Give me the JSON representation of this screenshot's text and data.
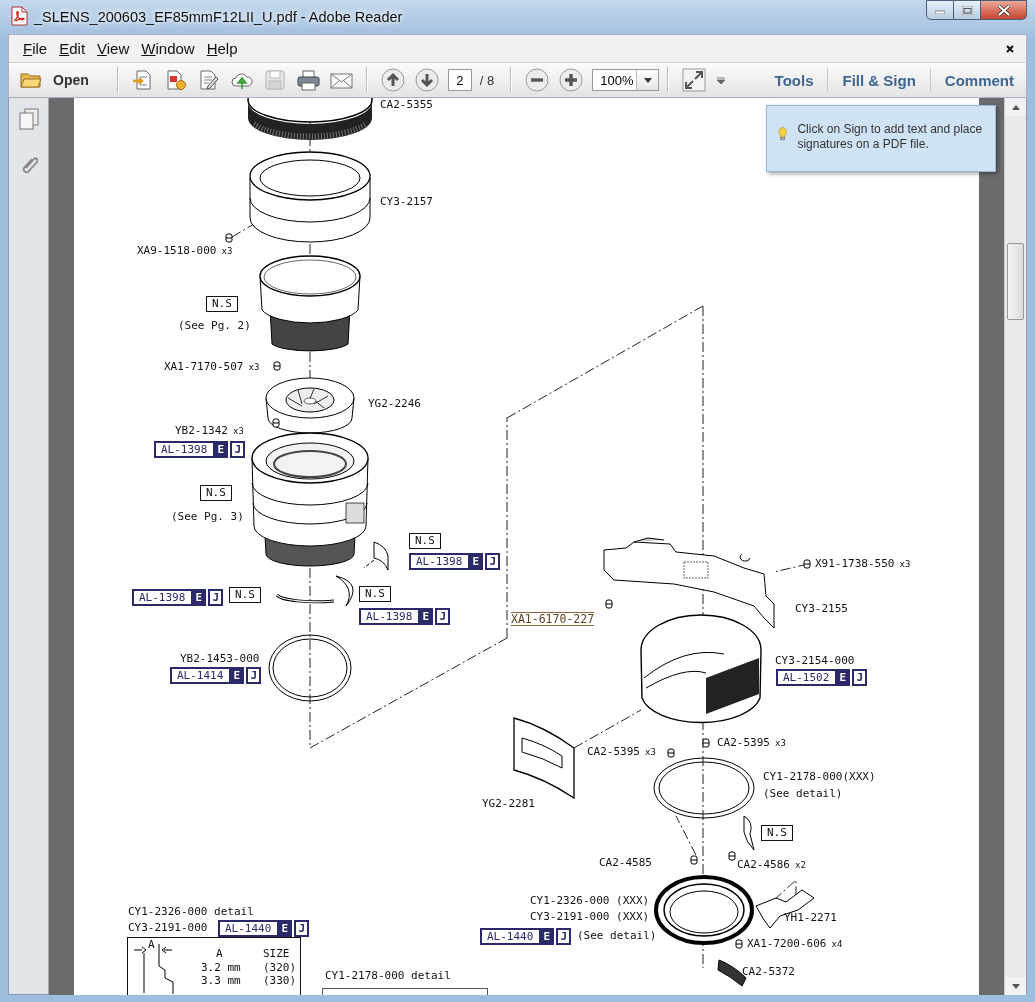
{
  "window": {
    "title": "_SLENS_200603_EF85mmF12LII_U.pdf - Adobe Reader"
  },
  "menu": [
    {
      "label": "File"
    },
    {
      "label": "Edit"
    },
    {
      "label": "View"
    },
    {
      "label": "Window"
    },
    {
      "label": "Help"
    }
  ],
  "toolbar": {
    "open_label": "Open",
    "page_number": "2",
    "page_total": "/ 8",
    "zoom": "100%",
    "panels": [
      {
        "label": "Tools"
      },
      {
        "label": "Fill & Sign"
      },
      {
        "label": "Comment"
      }
    ]
  },
  "tooltip": {
    "text": "Click on Sign to add text and place signatures on a PDF file."
  },
  "diagram": {
    "labels": [
      {
        "kind": "part",
        "text": "CA2-5355"
      },
      {
        "kind": "part",
        "text": "CY3-2157"
      },
      {
        "kind": "part",
        "text": "XA9-1518-000",
        "qty": "x3"
      },
      {
        "kind": "ns",
        "text": "N.S"
      },
      {
        "kind": "note",
        "text": "(See Pg. 2)"
      },
      {
        "kind": "part",
        "text": "XA1-7170-507",
        "qty": "x3"
      },
      {
        "kind": "part",
        "text": "YG2-2246"
      },
      {
        "kind": "part",
        "text": "YB2-1342",
        "qty": "x3"
      },
      {
        "kind": "ref",
        "text": "AL-1398",
        "badges": [
          {
            "text": "E",
            "filled": true
          },
          {
            "text": "J",
            "filled": false
          }
        ]
      },
      {
        "kind": "ns",
        "text": "N.S"
      },
      {
        "kind": "note",
        "text": "(See Pg. 3)"
      },
      {
        "kind": "ns",
        "text": "N.S"
      },
      {
        "kind": "ref",
        "text": "AL-1398",
        "badges": [
          {
            "text": "E",
            "filled": true
          },
          {
            "text": "J",
            "filled": false
          }
        ]
      },
      {
        "kind": "ref",
        "text": "AL-1398",
        "badges": [
          {
            "text": "E",
            "filled": true
          },
          {
            "text": "J",
            "filled": false
          }
        ]
      },
      {
        "kind": "ns",
        "text": "N.S"
      },
      {
        "kind": "ns",
        "text": "N.S"
      },
      {
        "kind": "ref",
        "text": "AL-1398",
        "badges": [
          {
            "text": "E",
            "filled": true
          },
          {
            "text": "J",
            "filled": false
          }
        ]
      },
      {
        "kind": "part",
        "text": "YB2-1453-000"
      },
      {
        "kind": "ref",
        "text": "AL-1414",
        "badges": [
          {
            "text": "E",
            "filled": true
          },
          {
            "text": "J",
            "filled": false
          }
        ]
      },
      {
        "kind": "struck",
        "text": "XA1-6170-227"
      },
      {
        "kind": "part",
        "text": "X91-1738-550",
        "qty": "x3"
      },
      {
        "kind": "part",
        "text": "CY3-2155"
      },
      {
        "kind": "part",
        "text": "CY3-2154-000"
      },
      {
        "kind": "ref",
        "text": "AL-1502",
        "badges": [
          {
            "text": "E",
            "filled": true
          },
          {
            "text": "J",
            "filled": false
          }
        ]
      },
      {
        "kind": "part",
        "text": "CA2-5395",
        "qty": "x3"
      },
      {
        "kind": "part",
        "text": "CA2-5395",
        "qty": "x3"
      },
      {
        "kind": "part",
        "text": "CY1-2178-000(XXX)"
      },
      {
        "kind": "note",
        "text": "(See detail)"
      },
      {
        "kind": "part",
        "text": "YG2-2281"
      },
      {
        "kind": "ns",
        "text": "N.S"
      },
      {
        "kind": "part",
        "text": "CA2-4585"
      },
      {
        "kind": "part",
        "text": "CA2-4586",
        "qty": "x2"
      },
      {
        "kind": "part",
        "text": "CY1-2326-000 (XXX)"
      },
      {
        "kind": "part",
        "text": "CY3-2191-000 (XXX)"
      },
      {
        "kind": "ref",
        "text": "AL-1440",
        "badges": [
          {
            "text": "E",
            "filled": true
          },
          {
            "text": "J",
            "filled": false
          }
        ]
      },
      {
        "kind": "note",
        "text": "(See detail)"
      },
      {
        "kind": "part",
        "text": "YH1-2271"
      },
      {
        "kind": "part",
        "text": "XA1-7200-606",
        "qty": "x4"
      },
      {
        "kind": "part",
        "text": "CA2-5372"
      },
      {
        "kind": "heading",
        "text": "CY1-2326-000 detail"
      },
      {
        "kind": "part",
        "text": "CY3-2191-000"
      },
      {
        "kind": "ref",
        "text": "AL-1440",
        "badges": [
          {
            "text": "E",
            "filled": true
          },
          {
            "text": "J",
            "filled": false
          }
        ]
      },
      {
        "kind": "heading",
        "text": "CY1-2178-000 detail"
      }
    ]
  },
  "detail_table": {
    "dimension_label": "A",
    "columns": [
      "A",
      "SIZE"
    ],
    "rows": [
      [
        "3.2 mm",
        "(320)"
      ],
      [
        "3.3 mm",
        "(330)"
      ]
    ]
  }
}
